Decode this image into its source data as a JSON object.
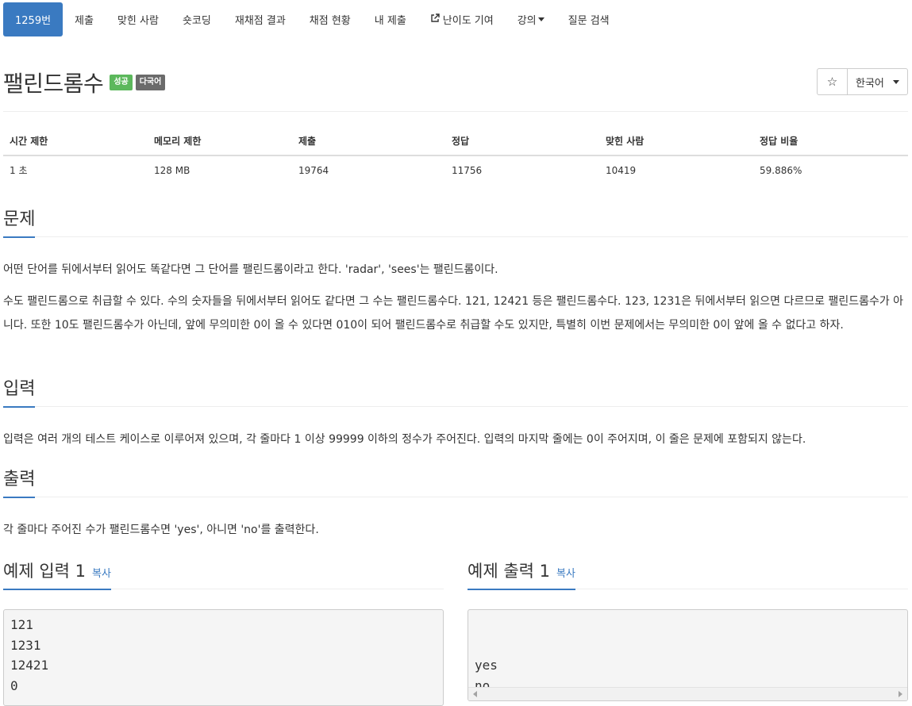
{
  "tabs": [
    {
      "label": "1259번",
      "active": true
    },
    {
      "label": "제출"
    },
    {
      "label": "맞힌 사람"
    },
    {
      "label": "숏코딩"
    },
    {
      "label": "재채점 결과"
    },
    {
      "label": "채점 현황"
    },
    {
      "label": "내 제출"
    },
    {
      "label": "난이도 기여",
      "icon": "external-link-icon"
    },
    {
      "label": "강의",
      "dropdown": true
    },
    {
      "label": "질문 검색"
    }
  ],
  "problem": {
    "title": "팰린드롬수",
    "badges": {
      "success": "성공",
      "multilang": "다국어"
    },
    "star_icon": "☆",
    "language": "한국어"
  },
  "stats": {
    "headers": [
      "시간 제한",
      "메모리 제한",
      "제출",
      "정답",
      "맞힌 사람",
      "정답 비율"
    ],
    "values": [
      "1 초",
      "128 MB",
      "19764",
      "11756",
      "10419",
      "59.886%"
    ]
  },
  "sections": {
    "problem_heading": "문제",
    "problem_p1": "어떤 단어를 뒤에서부터 읽어도 똑같다면 그 단어를 팰린드롬이라고 한다. 'radar', 'sees'는 팰린드롬이다.",
    "problem_p2": "수도 팰린드롬으로 취급할 수 있다. 수의 숫자들을 뒤에서부터 읽어도 같다면 그 수는 팰린드롬수다. 121, 12421 등은 팰린드롬수다. 123, 1231은 뒤에서부터 읽으면 다르므로 팰린드롬수가 아니다. 또한 10도 팰린드롬수가 아닌데, 앞에 무의미한 0이 올 수 있다면 010이 되어 팰린드롬수로 취급할 수도 있지만, 특별히 이번 문제에서는 무의미한 0이 앞에 올 수 없다고 하자.",
    "input_heading": "입력",
    "input_p": "입력은 여러 개의 테스트 케이스로 이루어져 있으며, 각 줄마다 1 이상 99999 이하의 정수가 주어진다. 입력의 마지막 줄에는 0이 주어지며, 이 줄은 문제에 포함되지 않는다.",
    "output_heading": "출력",
    "output_p": "각 줄마다 주어진 수가 팰린드롬수면 'yes', 아니면 'no'를 출력한다."
  },
  "samples": {
    "input_heading": "예제 입력 1",
    "output_heading": "예제 출력 1",
    "copy_label": "복사",
    "input_text": "121\n1231\n12421\n0",
    "output_text": "yes\nno\nyes"
  },
  "colors": {
    "accent": "#3a7ac1",
    "success": "#5cb85c",
    "badge_gray": "#6b6b6b"
  }
}
